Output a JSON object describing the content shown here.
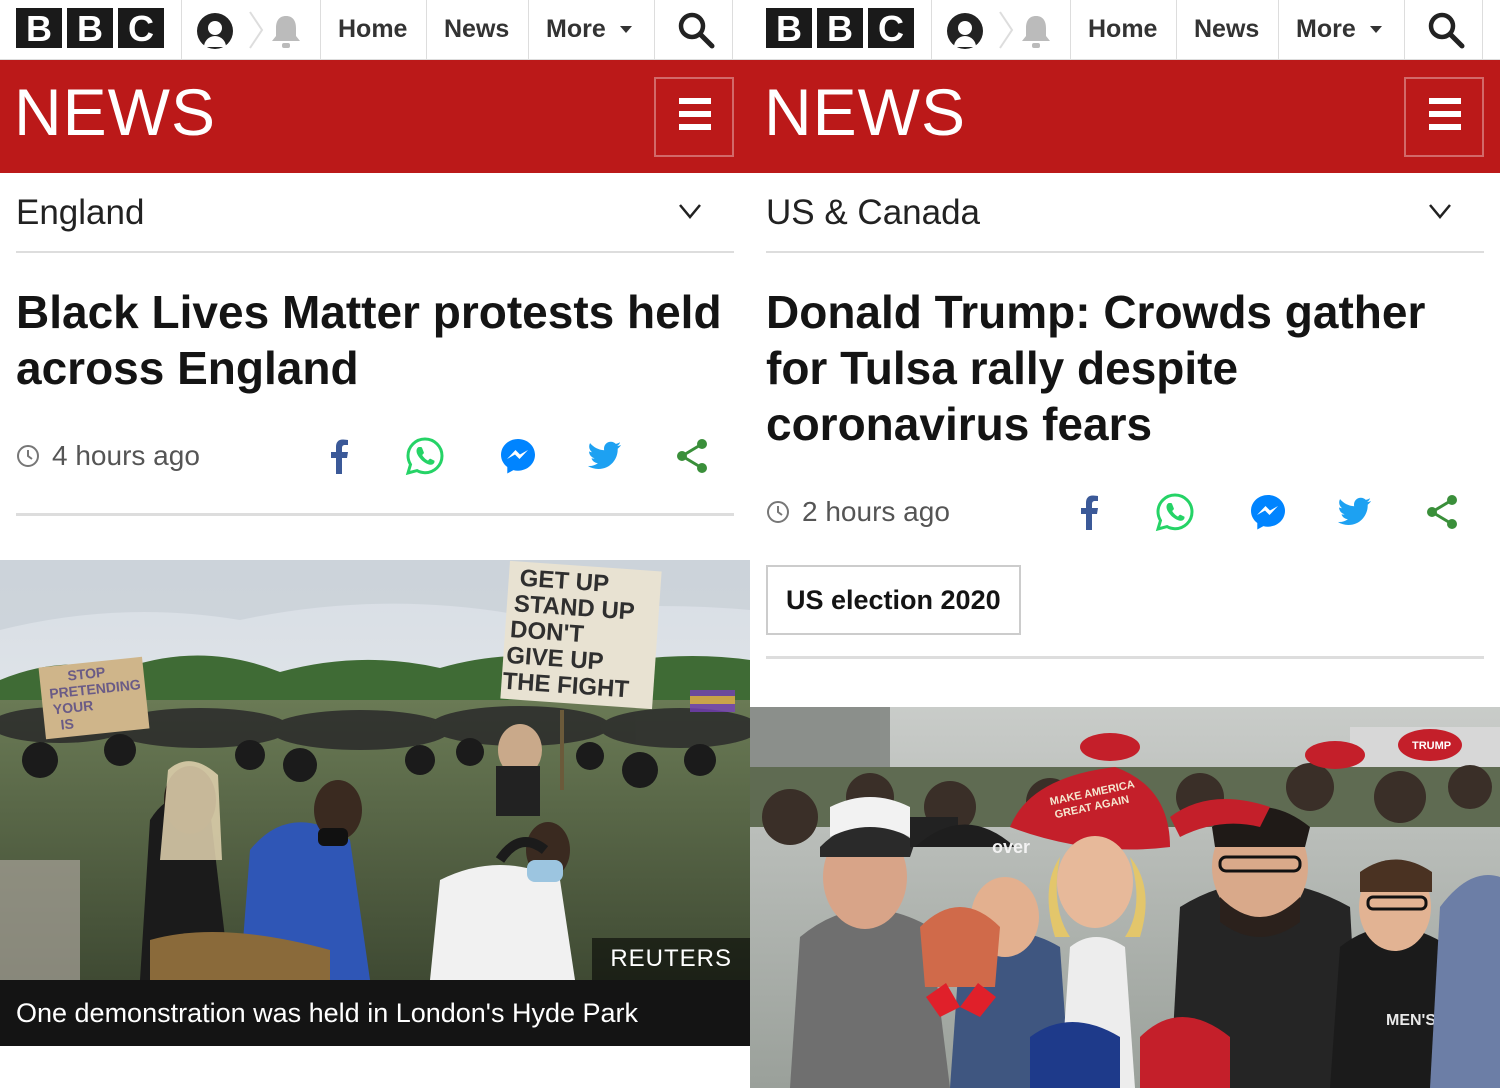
{
  "brand": {
    "letters": [
      "B",
      "B",
      "C"
    ],
    "news_title": "NEWS"
  },
  "nav": {
    "home": "Home",
    "news": "News",
    "more": "More"
  },
  "left": {
    "section": "England",
    "headline": "Black Lives Matter protests held across England",
    "time_ago": "4 hours ago",
    "image": {
      "credit": "REUTERS",
      "caption": "One demonstration was held in London's Hyde Park",
      "sign_main": [
        "GET UP",
        "STAND UP",
        "DON'T",
        "GIVE UP",
        "THE FIGHT"
      ],
      "sign_small": [
        "STOP",
        "PRETENDING",
        "YOUR",
        "IS"
      ]
    }
  },
  "right": {
    "section": "US & Canada",
    "headline": "Donald Trump: Crowds gather for Tulsa rally despite coronavirus fears",
    "time_ago": "2 hours ago",
    "tag": "US election 2020",
    "image": {
      "hat_text": [
        "MAKE AMERICA",
        "GREAT AGAIN"
      ],
      "cap_text": "TRUMP",
      "shirt_text": "MEN'S",
      "shirt_text2": "over"
    }
  },
  "colors": {
    "bbc_red": "#bb1919",
    "facebook": "#3b5998",
    "whatsapp": "#25d366",
    "messenger": "#0084ff",
    "twitter": "#1da1f2",
    "share": "#3a8f3a"
  },
  "icons": [
    "account-icon",
    "notifications-bell-icon",
    "search-icon",
    "menu-icon",
    "chevron-down-icon",
    "clock-icon",
    "facebook-icon",
    "whatsapp-icon",
    "messenger-icon",
    "twitter-icon",
    "share-icon"
  ]
}
